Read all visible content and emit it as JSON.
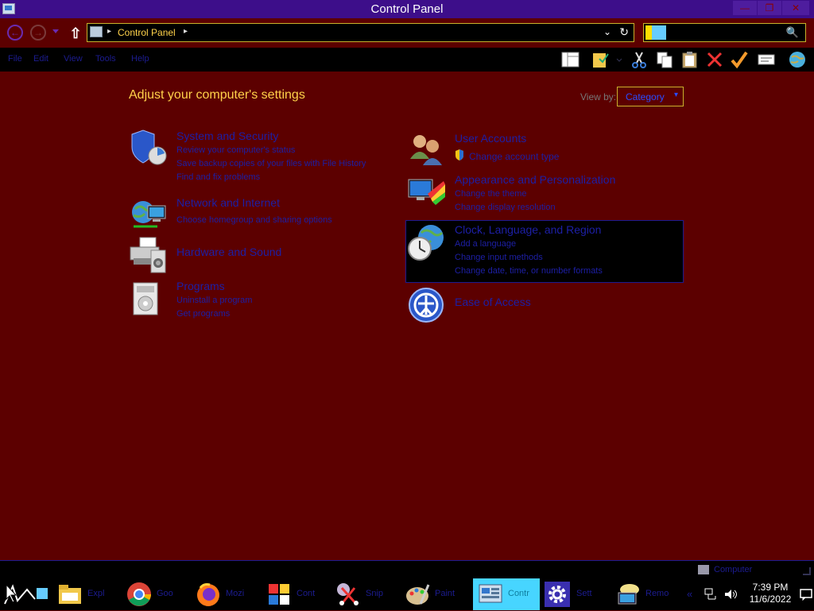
{
  "window": {
    "title": "Control Panel",
    "minimize": "—",
    "maximize": "❐",
    "close": "✕"
  },
  "nav": {
    "back_glyph": "←",
    "forward_glyph": "→",
    "up_glyph": "⇧",
    "address_crumb": "Control Panel",
    "crumb_sep": "▸",
    "dropdown_glyph": "⌄",
    "refresh_glyph": "↻",
    "search_glyph": "🔍",
    "search_value": ""
  },
  "menu": [
    "File",
    "Edit",
    "View",
    "Tools",
    "Help"
  ],
  "toolbar_icons": [
    "layout-icon",
    "folder-check-icon",
    "dropdown-icon",
    "cut-icon",
    "copy-icon",
    "paste-icon",
    "delete-icon",
    "checkmark-icon",
    "properties-icon",
    "globe-icon"
  ],
  "content": {
    "heading": "Adjust your computer's settings",
    "view_by_label": "View by:",
    "view_by_value": "Category",
    "view_by_chevron": "▾",
    "left": [
      {
        "title": "System and Security",
        "links": [
          "Review your computer's status",
          "Save backup copies of your files with File History",
          "Find and fix problems"
        ]
      },
      {
        "title": "Network and Internet",
        "links": [
          "Choose homegroup and sharing options"
        ]
      },
      {
        "title": "Hardware and Sound",
        "links": []
      },
      {
        "title": "Programs",
        "links": [
          "Uninstall a program",
          "Get programs"
        ]
      }
    ],
    "right": [
      {
        "title": "User Accounts",
        "links": [
          "Change account type"
        ]
      },
      {
        "title": "Appearance and Personalization",
        "links": [
          "Change the theme",
          "Change display resolution"
        ]
      },
      {
        "title": "Clock, Language, and Region",
        "links": [
          "Add a language",
          "Change input methods",
          "Change date, time, or number formats"
        ]
      },
      {
        "title": "Ease of Access",
        "links": []
      }
    ]
  },
  "statusbar": {
    "computer_label": "Computer"
  },
  "taskbar": {
    "items": [
      {
        "label": "",
        "icon": "cursor-icon"
      },
      {
        "label": "Expl",
        "icon": "file-explorer-icon"
      },
      {
        "label": "Goo",
        "icon": "chrome-icon"
      },
      {
        "label": "Mozi",
        "icon": "firefox-icon"
      },
      {
        "label": "Cont",
        "icon": "control-panel-icon"
      },
      {
        "label": "Snip",
        "icon": "scissors-icon"
      },
      {
        "label": "Paint",
        "icon": "paint-icon"
      },
      {
        "label": "Contr",
        "icon": "control-panel-icon"
      },
      {
        "label": "Sett",
        "icon": "settings-icon"
      },
      {
        "label": "Remo",
        "icon": "remote-desktop-icon"
      }
    ],
    "tray_expand": "«",
    "time": "7:39 PM",
    "date": "11/6/2022"
  }
}
